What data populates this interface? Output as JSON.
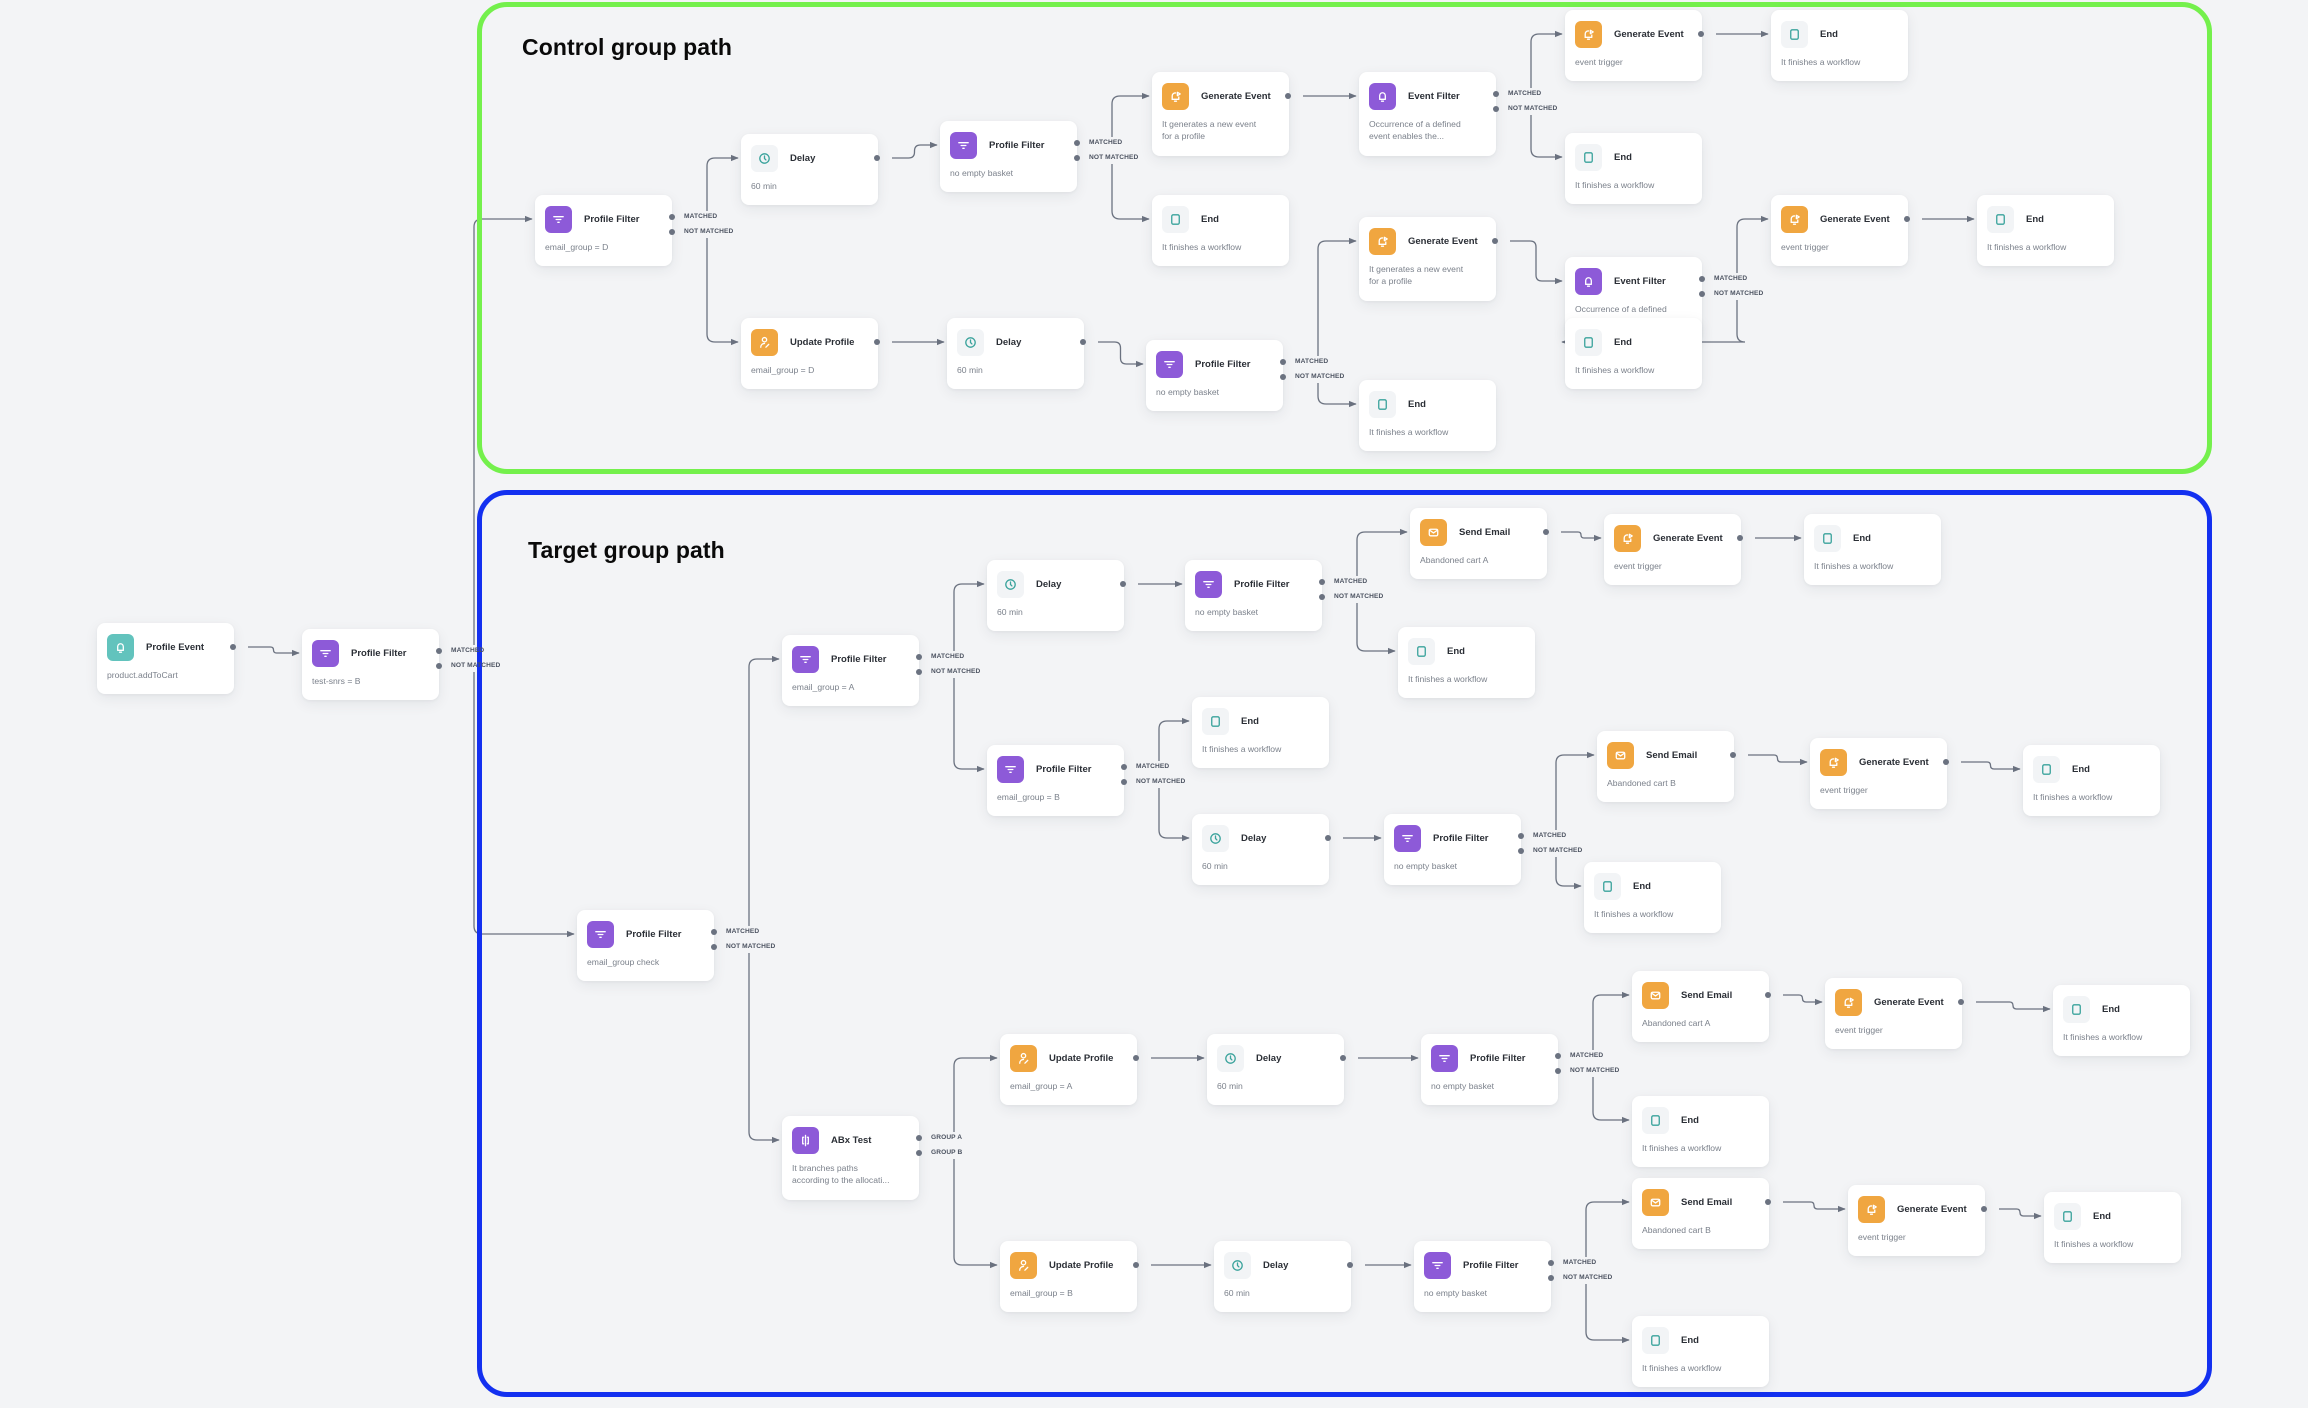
{
  "groups": {
    "control": {
      "title": "Control group path",
      "border_color": "#74f04c"
    },
    "target": {
      "title": "Target group path",
      "border_color": "#1330f0"
    }
  },
  "node_types": {
    "profile_event": {
      "icon": "bell-icon",
      "icon_bg": "#62c3bd",
      "icon_fg": "#ffffff"
    },
    "profile_filter": {
      "icon": "filter-icon",
      "icon_bg": "#8d5ad8",
      "icon_fg": "#ffffff"
    },
    "event_filter": {
      "icon": "bell-icon",
      "icon_bg": "#8d5ad8",
      "icon_fg": "#ffffff"
    },
    "abx_test": {
      "icon": "split-icon",
      "icon_bg": "#8d5ad8",
      "icon_fg": "#ffffff"
    },
    "delay": {
      "icon": "clock-icon",
      "icon_bg": "#f2f4f6",
      "icon_fg": "#3aa39c"
    },
    "end": {
      "icon": "square-icon",
      "icon_bg": "#f2f4f6",
      "icon_fg": "#3aa39c"
    },
    "update_profile": {
      "icon": "user-edit-icon",
      "icon_bg": "#f0a640",
      "icon_fg": "#ffffff"
    },
    "generate_event": {
      "icon": "bell-play-icon",
      "icon_bg": "#f0a640",
      "icon_fg": "#ffffff"
    },
    "send_email": {
      "icon": "envelope-icon",
      "icon_bg": "#f0a640",
      "icon_fg": "#ffffff"
    }
  },
  "port_labels": {
    "matched": "MATCHED",
    "not_matched": "NOT MATCHED",
    "group_a": "GROUP A",
    "group_b": "GROUP B"
  },
  "nodes": [
    {
      "id": "n1",
      "type": "profile_event",
      "title": "Profile Event",
      "desc": "product.addToCart",
      "ports": [
        "out"
      ]
    },
    {
      "id": "n2",
      "type": "profile_filter",
      "title": "Profile Filter",
      "desc": "test-snrs = B",
      "ports": [
        "matched",
        "not_matched"
      ]
    },
    {
      "id": "c1",
      "type": "profile_filter",
      "title": "Profile Filter",
      "desc": "email_group = D",
      "ports": [
        "matched",
        "not_matched"
      ]
    },
    {
      "id": "c2",
      "type": "delay",
      "title": "Delay",
      "desc": "60 min",
      "ports": [
        "out"
      ]
    },
    {
      "id": "c3",
      "type": "profile_filter",
      "title": "Profile Filter",
      "desc": "no empty basket",
      "ports": [
        "matched",
        "not_matched"
      ]
    },
    {
      "id": "c4",
      "type": "generate_event",
      "title": "Generate Event",
      "desc": "It generates a new event\nfor a profile",
      "ports": [
        "out"
      ]
    },
    {
      "id": "c5",
      "type": "end",
      "title": "End",
      "desc": "It finishes a workflow",
      "ports": []
    },
    {
      "id": "c6",
      "type": "event_filter",
      "title": "Event Filter",
      "desc": "Occurrence of a defined\nevent enables the...",
      "ports": [
        "matched",
        "not_matched"
      ]
    },
    {
      "id": "c7",
      "type": "generate_event",
      "title": "Generate Event",
      "desc": "event trigger",
      "ports": [
        "out"
      ]
    },
    {
      "id": "c8",
      "type": "end",
      "title": "End",
      "desc": "It finishes a workflow",
      "ports": []
    },
    {
      "id": "c9",
      "type": "end",
      "title": "End",
      "desc": "It finishes a workflow",
      "ports": []
    },
    {
      "id": "c10",
      "type": "update_profile",
      "title": "Update Profile",
      "desc": "email_group = D",
      "ports": [
        "out"
      ]
    },
    {
      "id": "c11",
      "type": "delay",
      "title": "Delay",
      "desc": "60 min",
      "ports": [
        "out"
      ]
    },
    {
      "id": "c12",
      "type": "profile_filter",
      "title": "Profile Filter",
      "desc": "no empty basket",
      "ports": [
        "matched",
        "not_matched"
      ]
    },
    {
      "id": "c13",
      "type": "generate_event",
      "title": "Generate Event",
      "desc": "It generates a new event\nfor a profile",
      "ports": [
        "out"
      ]
    },
    {
      "id": "c14",
      "type": "end",
      "title": "End",
      "desc": "It finishes a workflow",
      "ports": []
    },
    {
      "id": "c15",
      "type": "event_filter",
      "title": "Event Filter",
      "desc": "Occurrence of a defined\nevent enables the...",
      "ports": [
        "matched",
        "not_matched"
      ]
    },
    {
      "id": "c16",
      "type": "generate_event",
      "title": "Generate Event",
      "desc": "event trigger",
      "ports": [
        "out"
      ]
    },
    {
      "id": "c17",
      "type": "end",
      "title": "End",
      "desc": "It finishes a workflow",
      "ports": []
    },
    {
      "id": "c18",
      "type": "end",
      "title": "End",
      "desc": "It finishes a workflow",
      "ports": []
    },
    {
      "id": "t1",
      "type": "profile_filter",
      "title": "Profile Filter",
      "desc": "email_group check",
      "ports": [
        "matched",
        "not_matched"
      ]
    },
    {
      "id": "t2",
      "type": "profile_filter",
      "title": "Profile Filter",
      "desc": "email_group = A",
      "ports": [
        "matched",
        "not_matched"
      ]
    },
    {
      "id": "t3",
      "type": "delay",
      "title": "Delay",
      "desc": "60 min",
      "ports": [
        "out"
      ]
    },
    {
      "id": "t4",
      "type": "profile_filter",
      "title": "Profile Filter",
      "desc": "no empty basket",
      "ports": [
        "matched",
        "not_matched"
      ]
    },
    {
      "id": "t5",
      "type": "send_email",
      "title": "Send Email",
      "desc": "Abandoned cart A",
      "ports": [
        "out"
      ]
    },
    {
      "id": "t6",
      "type": "generate_event",
      "title": "Generate Event",
      "desc": "event trigger",
      "ports": [
        "out"
      ]
    },
    {
      "id": "t7",
      "type": "end",
      "title": "End",
      "desc": "It finishes a workflow",
      "ports": []
    },
    {
      "id": "t8",
      "type": "end",
      "title": "End",
      "desc": "It finishes a workflow",
      "ports": []
    },
    {
      "id": "t9",
      "type": "profile_filter",
      "title": "Profile Filter",
      "desc": "email_group = B",
      "ports": [
        "matched",
        "not_matched"
      ]
    },
    {
      "id": "t10",
      "type": "end",
      "title": "End",
      "desc": "It finishes a workflow",
      "ports": []
    },
    {
      "id": "t11",
      "type": "delay",
      "title": "Delay",
      "desc": "60 min",
      "ports": [
        "out"
      ]
    },
    {
      "id": "t12",
      "type": "profile_filter",
      "title": "Profile Filter",
      "desc": "no empty basket",
      "ports": [
        "matched",
        "not_matched"
      ]
    },
    {
      "id": "t13",
      "type": "send_email",
      "title": "Send Email",
      "desc": "Abandoned cart B",
      "ports": [
        "out"
      ]
    },
    {
      "id": "t14",
      "type": "generate_event",
      "title": "Generate Event",
      "desc": "event trigger",
      "ports": [
        "out"
      ]
    },
    {
      "id": "t15",
      "type": "end",
      "title": "End",
      "desc": "It finishes a workflow",
      "ports": []
    },
    {
      "id": "t16",
      "type": "end",
      "title": "End",
      "desc": "It finishes a workflow",
      "ports": []
    },
    {
      "id": "t17",
      "type": "abx_test",
      "title": "ABx Test",
      "desc": "It branches paths\naccording to the allocati...",
      "ports": [
        "group_a",
        "group_b"
      ]
    },
    {
      "id": "t18",
      "type": "update_profile",
      "title": "Update Profile",
      "desc": "email_group = A",
      "ports": [
        "out"
      ]
    },
    {
      "id": "t19",
      "type": "delay",
      "title": "Delay",
      "desc": "60 min",
      "ports": [
        "out"
      ]
    },
    {
      "id": "t20",
      "type": "profile_filter",
      "title": "Profile Filter",
      "desc": "no empty basket",
      "ports": [
        "matched",
        "not_matched"
      ]
    },
    {
      "id": "t21",
      "type": "send_email",
      "title": "Send Email",
      "desc": "Abandoned cart A",
      "ports": [
        "out"
      ]
    },
    {
      "id": "t22",
      "type": "generate_event",
      "title": "Generate Event",
      "desc": "event trigger",
      "ports": [
        "out"
      ]
    },
    {
      "id": "t23",
      "type": "end",
      "title": "End",
      "desc": "It finishes a workflow",
      "ports": []
    },
    {
      "id": "t24",
      "type": "end",
      "title": "End",
      "desc": "It finishes a workflow",
      "ports": []
    },
    {
      "id": "t25",
      "type": "update_profile",
      "title": "Update Profile",
      "desc": "email_group = B",
      "ports": [
        "out"
      ]
    },
    {
      "id": "t26",
      "type": "delay",
      "title": "Delay",
      "desc": "60 min",
      "ports": [
        "out"
      ]
    },
    {
      "id": "t27",
      "type": "profile_filter",
      "title": "Profile Filter",
      "desc": "no empty basket",
      "ports": [
        "matched",
        "not_matched"
      ]
    },
    {
      "id": "t28",
      "type": "send_email",
      "title": "Send Email",
      "desc": "Abandoned cart B",
      "ports": [
        "out"
      ]
    },
    {
      "id": "t29",
      "type": "generate_event",
      "title": "Generate Event",
      "desc": "event trigger",
      "ports": [
        "out"
      ]
    },
    {
      "id": "t30",
      "type": "end",
      "title": "End",
      "desc": "It finishes a workflow",
      "ports": []
    },
    {
      "id": "t31",
      "type": "end",
      "title": "End",
      "desc": "It finishes a workflow",
      "ports": []
    }
  ],
  "edges": [
    {
      "from": "n1",
      "port": "out",
      "to": "n2"
    },
    {
      "from": "n2",
      "port": "matched",
      "to": "c1"
    },
    {
      "from": "n2",
      "port": "not_matched",
      "to": "t1"
    },
    {
      "from": "c1",
      "port": "matched",
      "to": "c2"
    },
    {
      "from": "c1",
      "port": "not_matched",
      "to": "c10"
    },
    {
      "from": "c2",
      "port": "out",
      "to": "c3"
    },
    {
      "from": "c3",
      "port": "matched",
      "to": "c4"
    },
    {
      "from": "c3",
      "port": "not_matched",
      "to": "c5"
    },
    {
      "from": "c4",
      "port": "out",
      "to": "c6"
    },
    {
      "from": "c6",
      "port": "matched",
      "to": "c7"
    },
    {
      "from": "c6",
      "port": "not_matched",
      "to": "c9"
    },
    {
      "from": "c7",
      "port": "out",
      "to": "c8"
    },
    {
      "from": "c10",
      "port": "out",
      "to": "c11"
    },
    {
      "from": "c11",
      "port": "out",
      "to": "c12"
    },
    {
      "from": "c12",
      "port": "matched",
      "to": "c13"
    },
    {
      "from": "c12",
      "port": "not_matched",
      "to": "c14"
    },
    {
      "from": "c13",
      "port": "out",
      "to": "c15"
    },
    {
      "from": "c15",
      "port": "matched",
      "to": "c16"
    },
    {
      "from": "c15",
      "port": "not_matched",
      "to": "c18"
    },
    {
      "from": "c16",
      "port": "out",
      "to": "c17"
    },
    {
      "from": "t1",
      "port": "matched",
      "to": "t2"
    },
    {
      "from": "t1",
      "port": "not_matched",
      "to": "t17"
    },
    {
      "from": "t2",
      "port": "matched",
      "to": "t3"
    },
    {
      "from": "t2",
      "port": "not_matched",
      "to": "t9"
    },
    {
      "from": "t3",
      "port": "out",
      "to": "t4"
    },
    {
      "from": "t4",
      "port": "matched",
      "to": "t5"
    },
    {
      "from": "t4",
      "port": "not_matched",
      "to": "t8"
    },
    {
      "from": "t5",
      "port": "out",
      "to": "t6"
    },
    {
      "from": "t6",
      "port": "out",
      "to": "t7"
    },
    {
      "from": "t9",
      "port": "matched",
      "to": "t10"
    },
    {
      "from": "t9",
      "port": "not_matched",
      "to": "t11"
    },
    {
      "from": "t11",
      "port": "out",
      "to": "t12"
    },
    {
      "from": "t12",
      "port": "matched",
      "to": "t13"
    },
    {
      "from": "t12",
      "port": "not_matched",
      "to": "t16"
    },
    {
      "from": "t13",
      "port": "out",
      "to": "t14"
    },
    {
      "from": "t14",
      "port": "out",
      "to": "t15"
    },
    {
      "from": "t17",
      "port": "group_a",
      "to": "t18"
    },
    {
      "from": "t17",
      "port": "group_b",
      "to": "t25"
    },
    {
      "from": "t18",
      "port": "out",
      "to": "t19"
    },
    {
      "from": "t19",
      "port": "out",
      "to": "t20"
    },
    {
      "from": "t20",
      "port": "matched",
      "to": "t21"
    },
    {
      "from": "t20",
      "port": "not_matched",
      "to": "t24"
    },
    {
      "from": "t21",
      "port": "out",
      "to": "t22"
    },
    {
      "from": "t22",
      "port": "out",
      "to": "t23"
    },
    {
      "from": "t25",
      "port": "out",
      "to": "t26"
    },
    {
      "from": "t26",
      "port": "out",
      "to": "t27"
    },
    {
      "from": "t27",
      "port": "matched",
      "to": "t28"
    },
    {
      "from": "t27",
      "port": "not_matched",
      "to": "t31"
    },
    {
      "from": "t28",
      "port": "out",
      "to": "t29"
    },
    {
      "from": "t29",
      "port": "out",
      "to": "t30"
    }
  ]
}
